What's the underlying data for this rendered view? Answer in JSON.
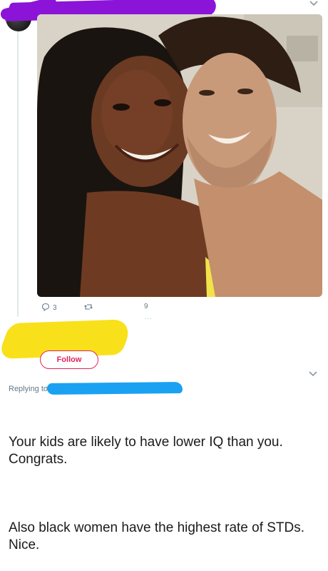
{
  "top_tweet": {
    "actions": {
      "reply_count": "3",
      "retweet_count": "",
      "like_count": "9"
    }
  },
  "reply": {
    "follow_label": "Follow",
    "replying_to_prefix": "Replying to",
    "paragraphs": [
      "Your kids are likely to have lower IQ than you. Congrats.",
      "Also black women have the highest rate of STDs. Nice."
    ]
  },
  "colors": {
    "accent_pink": "#e0245e",
    "redaction_purple": "#8b14d8",
    "redaction_yellow": "#f8e11a",
    "redaction_blue": "#1ba1f2",
    "muted_text": "#657786"
  },
  "icons": {
    "reply": "reply-icon",
    "retweet": "retweet-icon",
    "like": "like-icon",
    "more": "chevron-down-icon"
  }
}
